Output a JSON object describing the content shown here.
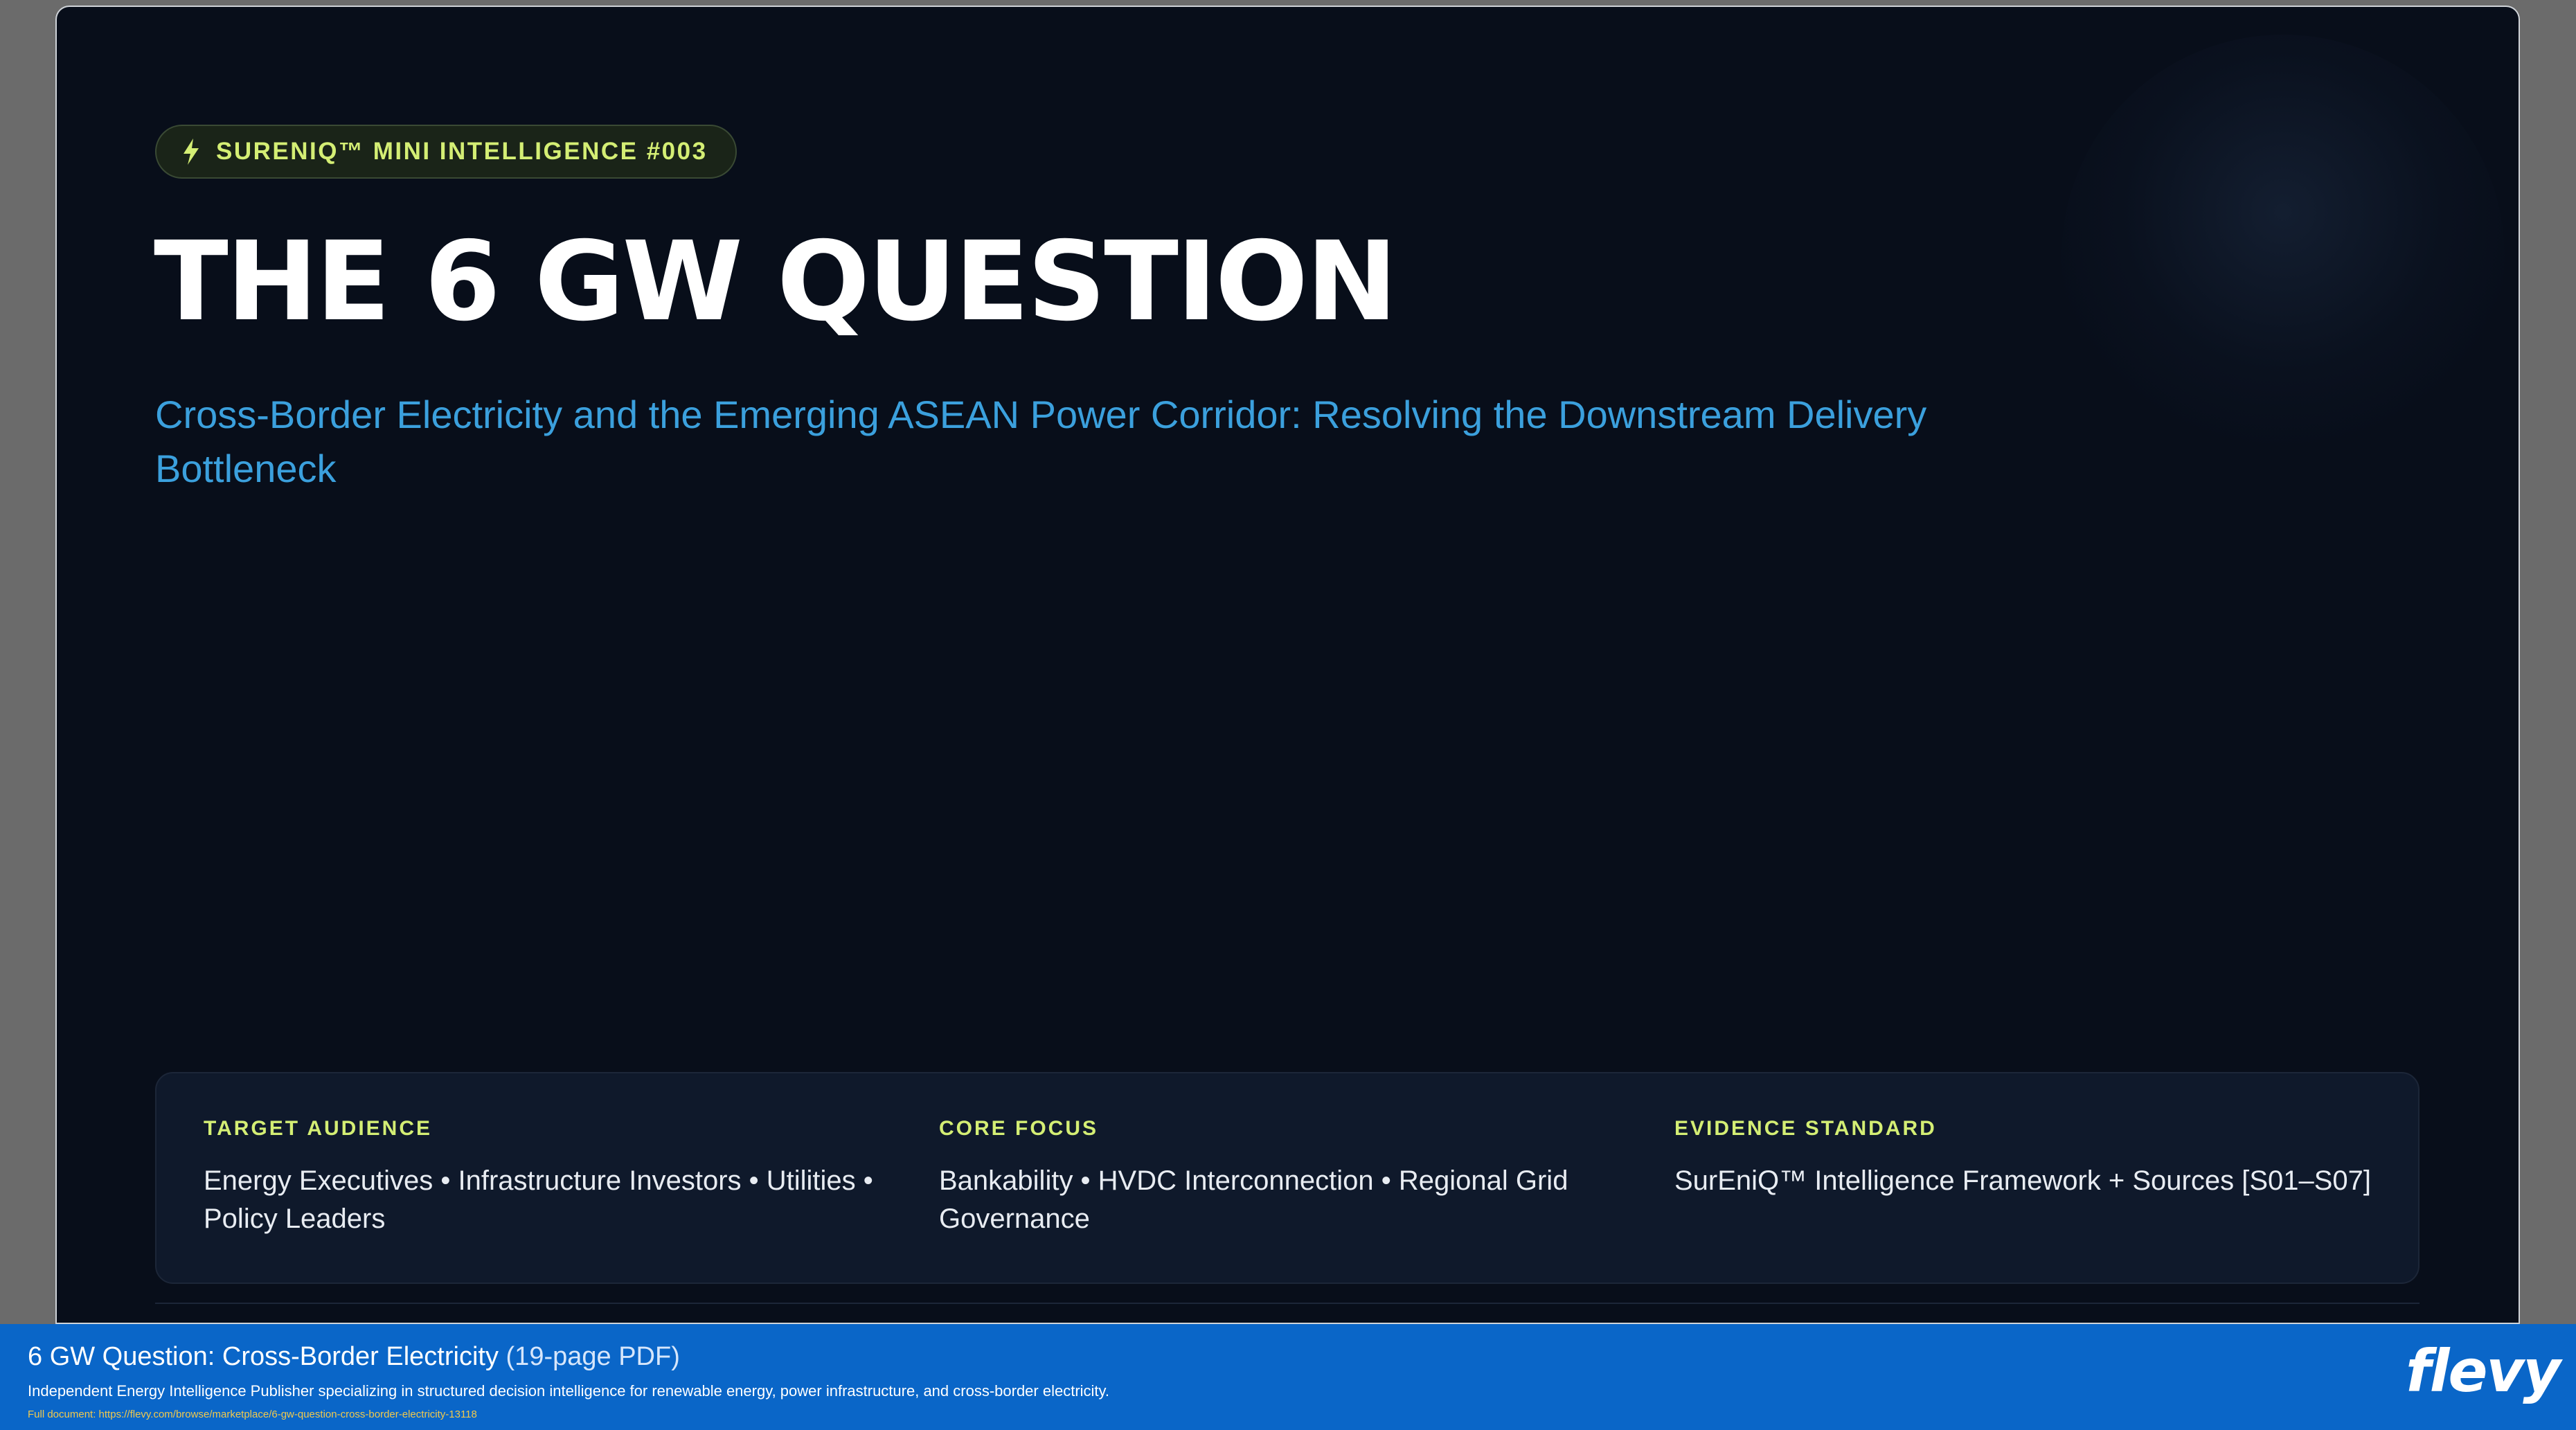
{
  "slide": {
    "badge": {
      "icon": "lightning-bolt-icon",
      "text": "SURENIQ™ MINI INTELLIGENCE #003"
    },
    "title": "THE 6 GW QUESTION",
    "subtitle": "Cross-Border Electricity and the Emerging ASEAN Power Corridor: Resolving the Downstream Delivery Bottleneck",
    "panel": {
      "columns": [
        {
          "label": "TARGET AUDIENCE",
          "value": "Energy Executives • Infrastructure Investors • Utilities • Policy Leaders"
        },
        {
          "label": "CORE FOCUS",
          "value": "Bankability • HVDC Interconnection • Regional Grid Governance"
        },
        {
          "label": "EVIDENCE STANDARD",
          "value": "SurEniQ™ Intelligence Framework + Sources [S01–S07]"
        }
      ]
    }
  },
  "footer": {
    "title": "6 GW Question: Cross-Border Electricity",
    "pages": "(19-page PDF)",
    "description": "Independent Energy Intelligence Publisher specializing in structured decision intelligence for renewable energy, power infrastructure, and cross-border electricity.",
    "url": "Full document: https://flevy.com/browse/marketplace/6-gw-question-cross-border-electricity-13118",
    "brand": "flevy"
  },
  "colors": {
    "background": "#080e1a",
    "accent_lime": "#d4ee74",
    "accent_blue": "#3ba0dd",
    "footer_blue": "#0a66c8"
  }
}
